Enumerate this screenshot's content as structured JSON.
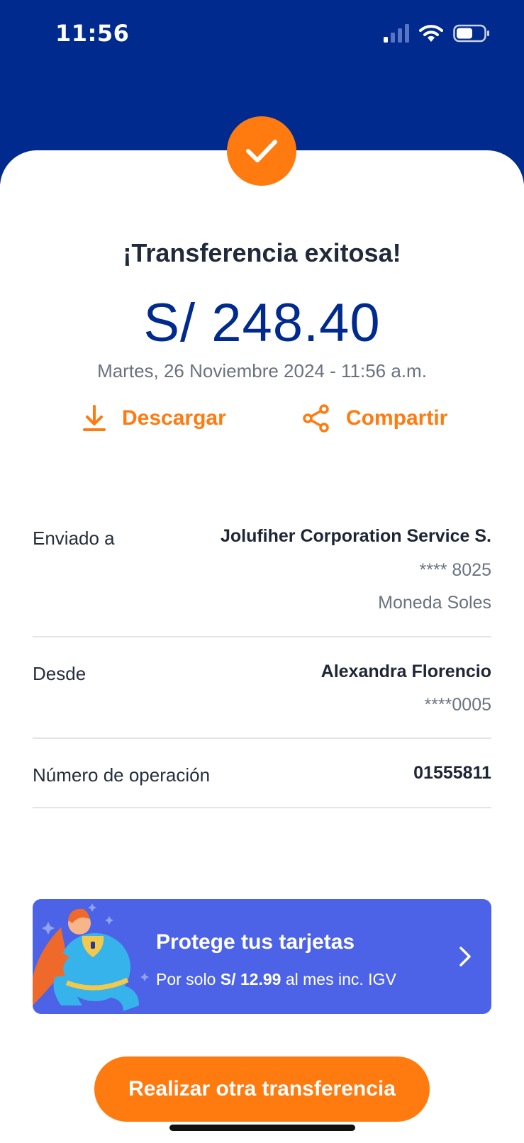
{
  "status_bar": {
    "time": "11:56"
  },
  "receipt": {
    "title": "¡Transferencia exitosa!",
    "amount": "S/ 248.40",
    "datetime": "Martes, 26 Noviembre 2024 - 11:56 a.m."
  },
  "actions": {
    "download_label": "Descargar",
    "share_label": "Compartir"
  },
  "details": {
    "sent_to": {
      "label": "Enviado a",
      "name": "Jolufiher Corporation Service S.",
      "account": "**** 8025",
      "currency": "Moneda Soles"
    },
    "from": {
      "label": "Desde",
      "name": "Alexandra Florencio",
      "account": "****0005"
    },
    "operation": {
      "label": "Número de operación",
      "number": "01555811"
    }
  },
  "promo": {
    "title": "Protege tus tarjetas",
    "sub_prefix": "Por solo",
    "sub_price": "S/ 12.99",
    "sub_suffix": "al mes inc. IGV"
  },
  "primary_button": {
    "label": "Realizar otra transferencia"
  },
  "colors": {
    "brand_blue": "#002a8d",
    "accent_orange": "#ff7a0f",
    "promo_blue": "#4c63e7"
  },
  "icons": {
    "success": "checkmark-icon",
    "download": "download-icon",
    "share": "share-icon",
    "promo_arrow": "chevron-right-icon"
  }
}
